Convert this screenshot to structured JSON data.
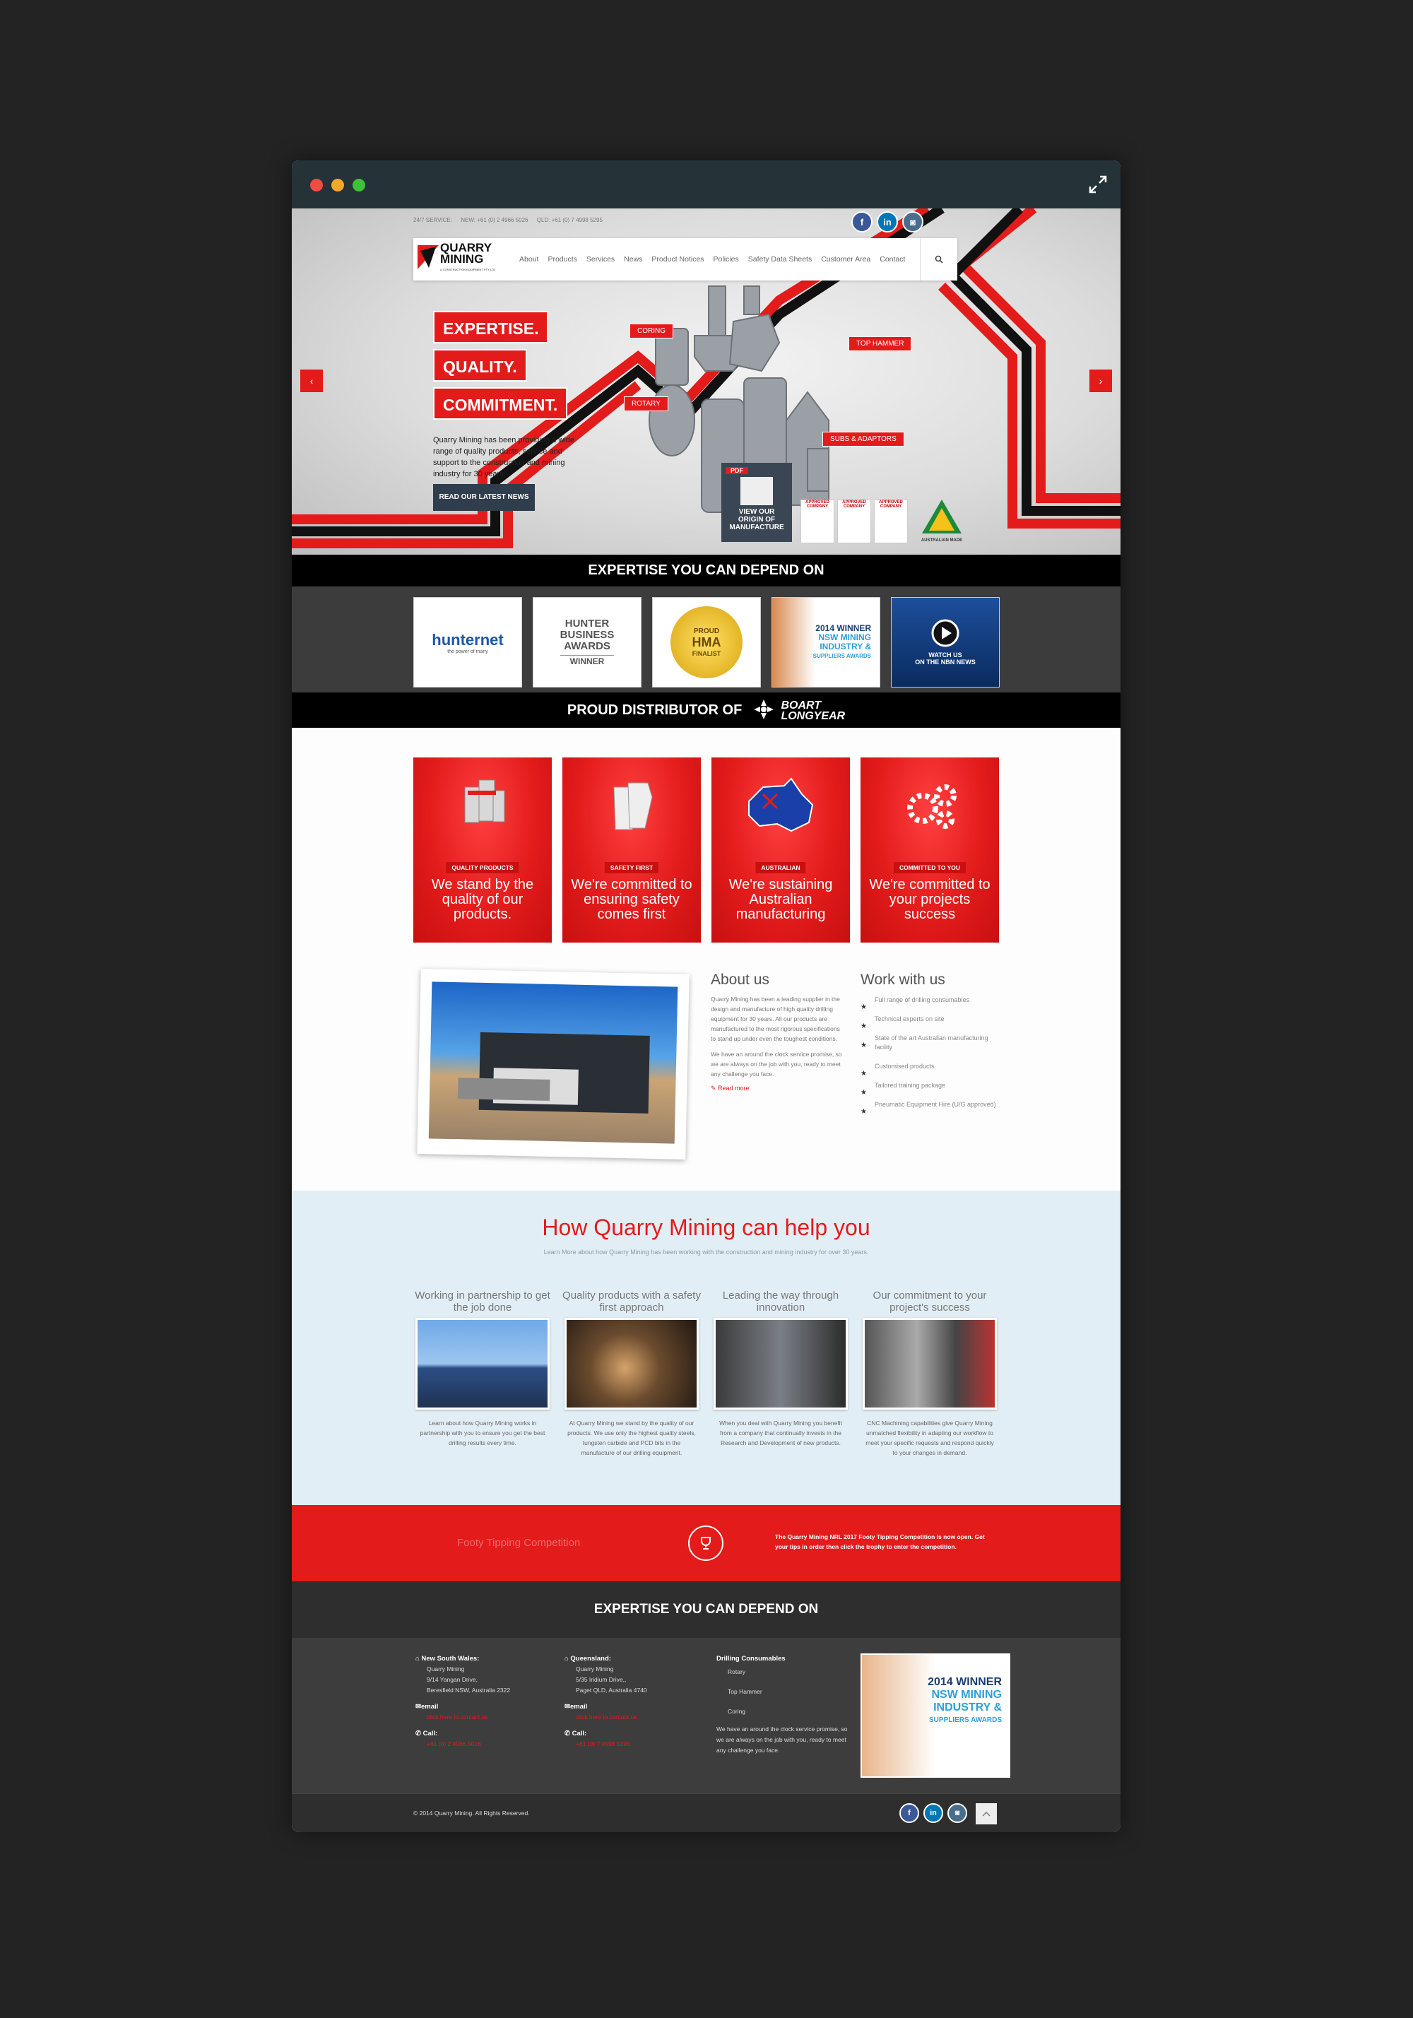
{
  "topbar": {
    "service": "24/7 SERVICE:",
    "nsw": "NEW: +61 (0) 2 4966 5026",
    "qld": "QLD: +61 (0) 7 4998 5295"
  },
  "social": {
    "facebook": "f",
    "linkedin": "in",
    "instagram": "◙"
  },
  "logo": {
    "line1": "QUARRY",
    "line2": "MINING",
    "line3": "& CONSTRUCTION EQUIPMENT PTY LTD"
  },
  "nav": [
    "About",
    "Products",
    "Services",
    "News",
    "Product Notices",
    "Policies",
    "Safety Data Sheets",
    "Customer Area",
    "Contact"
  ],
  "search_icon": "search-icon",
  "hero": {
    "tags": [
      "EXPERTISE.",
      "QUALITY.",
      "COMMITMENT."
    ],
    "text": "Quarry Mining has been providing a wide range of quality products, service and support to the construction and mining industry for 30 years.",
    "button": "READ OUR LATEST NEWS",
    "labels": {
      "coring": "CORING",
      "top_hammer": "TOP HAMMER",
      "rotary": "ROTARY",
      "subs": "SUBS & ADAPTORS"
    },
    "pdf": {
      "icon": "PDF",
      "text": "VIEW OUR ORIGIN OF MANUFACTURE"
    },
    "certs": [
      "APPROVED COMPANY",
      "APPROVED COMPANY",
      "APPROVED COMPANY"
    ],
    "australian_made": "AUSTRALIAN MADE",
    "prev": "‹",
    "next": "›"
  },
  "band1": "EXPERTISE YOU CAN DEPEND ON",
  "logos": {
    "hunternet": "hunternet",
    "hunternet_sub": "the power of many",
    "hba": {
      "l1": "HUNTER",
      "l2": "BUSINESS",
      "l3": "AWARDS",
      "l4": "WINNER"
    },
    "hma": {
      "l1": "PROUD",
      "l2": "HMA",
      "l3": "FINALIST"
    },
    "nsw": {
      "l1": "2014 WINNER",
      "l2": "NSW MINING",
      "l3": "INDUSTRY &",
      "l4": "SUPPLIERS AWARDS"
    },
    "news": {
      "l1": "WATCH US",
      "l2": "ON THE NBN NEWS"
    }
  },
  "band2": {
    "text": "PROUD DISTRIBUTOR OF",
    "brand1": "BOART",
    "brand2": "LONGYEAR"
  },
  "cards": [
    {
      "label": "QUALITY PRODUCTS",
      "text": "We stand by the quality of our products."
    },
    {
      "label": "SAFETY FIRST",
      "text": "We're committed to ensuring safety comes first"
    },
    {
      "label": "AUSTRALIAN",
      "text": "We're sustaining Australian manufacturing"
    },
    {
      "label": "COMMITTED TO YOU",
      "text": "We're committed to your projects success"
    }
  ],
  "about": {
    "title": "About us",
    "p1": "Quarry Mining has been a leading supplier in the design and manufacture of high quality drilling equipment for 30 years. All our products are manufactured to the most rigorous specifications to stand up under even the toughest conditions.",
    "p2": "We have an around the clock service promise, so we are always on the job with you, ready to meet any challenge you face.",
    "more": "Read more"
  },
  "work": {
    "title": "Work with us",
    "items": [
      "Full range of drilling consumables",
      "Technical experts on site",
      "State of the art Australian manufacturing facility",
      "Customised products",
      "Tailored training package",
      "Pneumatic Equipment Hire (U/G approved)"
    ]
  },
  "help": {
    "title": "How Quarry Mining can help you",
    "sub": "Learn More about how Quarry Mining has been working with the construction and mining industry for over 30 years.",
    "cols": [
      {
        "title": "Working in partnership to get the job done",
        "text": "Learn about how Quarry Mining works in partnership with you to ensure you get the best drilling results every time."
      },
      {
        "title": "Quality products with a safety first approach",
        "text": "At Quarry Mining we stand by the quality of our products. We use only the highest quality steels, tungsten carbide and PCD bits in the manufacture of our drilling equipment."
      },
      {
        "title": "Leading the way through innovation",
        "text": "When you deal with Quarry Mining you benefit from a company that continually invests in the Research and Development of new products."
      },
      {
        "title": "Our commitment to your project's success",
        "text": "CNC Machining capabilities give Quarry Mining unmatched flexibility in adapting our workflow to meet your specific requests and respond quickly to your changes in demand."
      }
    ]
  },
  "footy": {
    "title": "Footy Tipping Competition",
    "text": "The Quarry Mining NRL 2017 Footy Tipping Competition is now open. Get your tips in order then click the trophy to enter the competition."
  },
  "band3": "EXPERTISE YOU CAN DEPEND ON",
  "footer": {
    "nsw": {
      "head": "New South Wales:",
      "name": "Quarry Mining",
      "addr1": "9/14 Yangan Drive,",
      "addr2": "Beresfield NSW, Australia 2322",
      "email": "email",
      "email_link": "click here to contact us",
      "call": "Call:",
      "phone": "+61 (0) 2 4966 5026"
    },
    "qld": {
      "head": "Queensland:",
      "name": "Quarry Mining",
      "addr1": "5/35 Iridium Drive,,",
      "addr2": "Paget QLD, Australia 4740",
      "email": "email",
      "email_link": "click here to contact us",
      "call": "Call:",
      "phone": "+61 (0) 7 4998 5295"
    },
    "drill": {
      "head": "Drilling Consumables",
      "items": [
        "Rotary",
        "Top Hammer",
        "Coring"
      ],
      "text": "We have an around the clock service promise, so we are always on the job with you, ready to meet any challenge you face."
    },
    "award": {
      "l1": "2014 WINNER",
      "l2": "NSW MINING",
      "l3": "INDUSTRY &",
      "l4": "SUPPLIERS AWARDS"
    }
  },
  "copyright": "© 2014 Quarry Mining. All Rights Reserved.",
  "colors": {
    "accent": "#e31b1b",
    "dark": "#2e2e2e",
    "navy": "#2f3d4c"
  }
}
